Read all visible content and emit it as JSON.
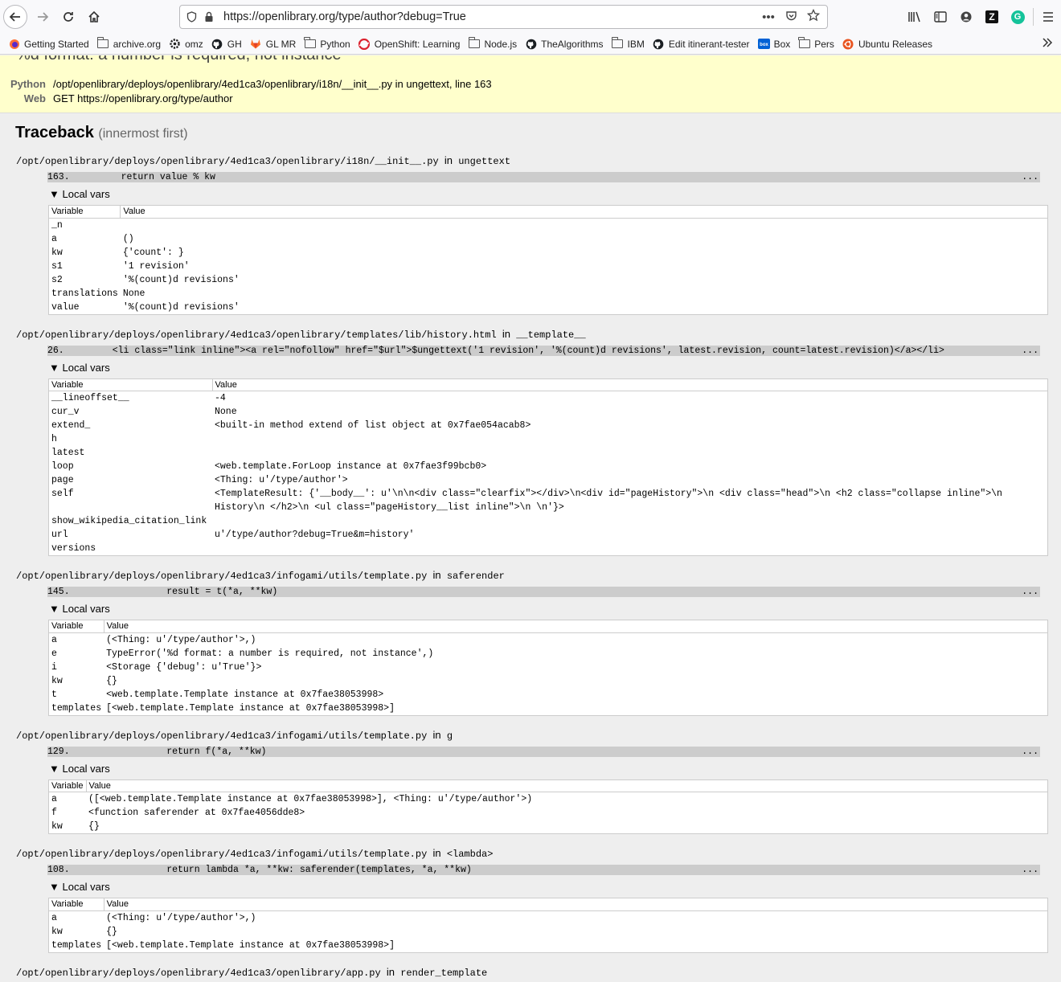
{
  "browser": {
    "url": "https://openlibrary.org/type/author?debug=True",
    "icons": [
      "back-arrow-icon",
      "forward-arrow-icon",
      "reload-icon",
      "home-icon",
      "shield-icon",
      "lock-icon",
      "more-dots-icon",
      "pocket-icon",
      "star-icon",
      "library-icon",
      "sidebar-icon",
      "account-icon",
      "zotero-icon",
      "grammarly-icon",
      "menu-icon"
    ],
    "zotero_letter": "Z",
    "grammarly_letter": "G",
    "more_dots": "•••"
  },
  "bookmarks": [
    {
      "label": "Getting Started",
      "icon": "firefox-icon"
    },
    {
      "label": "archive.org",
      "icon": "folder-icon"
    },
    {
      "label": "omz",
      "icon": "gear-icon"
    },
    {
      "label": "GH",
      "icon": "github-icon"
    },
    {
      "label": "GL MR",
      "icon": "gitlab-icon"
    },
    {
      "label": "Python",
      "icon": "folder-icon"
    },
    {
      "label": "OpenShift: Learning",
      "icon": "openshift-icon"
    },
    {
      "label": "Node.js",
      "icon": "folder-icon"
    },
    {
      "label": "TheAlgorithms",
      "icon": "github-icon"
    },
    {
      "label": "IBM",
      "icon": "folder-icon"
    },
    {
      "label": "Edit itinerant-tester",
      "icon": "github-icon"
    },
    {
      "label": "Box",
      "icon": "box-icon"
    },
    {
      "label": "Pers",
      "icon": "folder-icon"
    },
    {
      "label": "Ubuntu Releases",
      "icon": "ubuntu-icon"
    }
  ],
  "summary": {
    "title": "%d format: a number is required, not instance",
    "python_label": "Python",
    "python_value": "/opt/openlibrary/deploys/openlibrary/4ed1ca3/openlibrary/i18n/__init__.py in ungettext, line 163",
    "web_label": "Web",
    "web_value": "GET https://openlibrary.org/type/author"
  },
  "traceback": {
    "title": "Traceback",
    "subtitle": "(innermost first)",
    "in_word": "in",
    "local_vars_label": "▼ Local vars",
    "variable_header": "Variable",
    "value_header": "Value",
    "ellipsis": "...",
    "frames": [
      {
        "file": "/opt/openlibrary/deploys/openlibrary/4ed1ca3/openlibrary/i18n/__init__.py",
        "func": "ungettext",
        "line_no": "163.",
        "code": "return value % kw",
        "vars": [
          [
            "_n",
            ""
          ],
          [
            "a",
            "()"
          ],
          [
            "kw",
            "{'count': }"
          ],
          [
            "s1",
            "'1 revision'"
          ],
          [
            "s2",
            "'%(count)d revisions'"
          ],
          [
            "translations",
            "None"
          ],
          [
            "value",
            "'%(count)d revisions'"
          ]
        ]
      },
      {
        "file": "/opt/openlibrary/deploys/openlibrary/4ed1ca3/openlibrary/templates/lib/history.html",
        "func": "__template__",
        "line_no": "26.",
        "code": "<li class=\"link inline\"><a rel=\"nofollow\" href=\"$url\">$ungettext('1 revision', '%(count)d revisions', latest.revision, count=latest.revision)</a></li>",
        "vars": [
          [
            "__lineoffset__",
            "-4"
          ],
          [
            "cur_v",
            "None"
          ],
          [
            "extend_",
            "<built-in method extend of list object at 0x7fae054acab8>"
          ],
          [
            "h",
            ""
          ],
          [
            "latest",
            ""
          ],
          [
            "loop",
            "<web.template.ForLoop instance at 0x7fae3f99bcb0>"
          ],
          [
            "page",
            "<Thing: u'/type/author'>"
          ],
          [
            "self",
            "<TemplateResult: {'__body__': u'\\n\\n<div class=\"clearfix\"></div>\\n<div id=\"pageHistory\">\\n <div class=\"head\">\\n <h2 class=\"collapse inline\">\\n History\\n </h2>\\n <ul class=\"pageHistory__list inline\">\\n \\n'}>"
          ],
          [
            "show_wikipedia_citation_link",
            ""
          ],
          [
            "url",
            "u'/type/author?debug=True&m=history'"
          ],
          [
            "versions",
            ""
          ]
        ]
      },
      {
        "file": "/opt/openlibrary/deploys/openlibrary/4ed1ca3/infogami/utils/template.py",
        "func": "saferender",
        "line_no": "145.",
        "code": "    result = t(*a, **kw)",
        "vars": [
          [
            "a",
            "(<Thing: u'/type/author'>,)"
          ],
          [
            "e",
            "TypeError('%d format: a number is required, not instance',)"
          ],
          [
            "i",
            "<Storage {'debug': u'True'}>"
          ],
          [
            "kw",
            "{}"
          ],
          [
            "t",
            "<web.template.Template instance at 0x7fae38053998>"
          ],
          [
            "templates",
            "[<web.template.Template instance at 0x7fae38053998>]"
          ]
        ]
      },
      {
        "file": "/opt/openlibrary/deploys/openlibrary/4ed1ca3/infogami/utils/template.py",
        "func": "g",
        "line_no": "129.",
        "code": "    return f(*a, **kw)",
        "vars": [
          [
            "a",
            "([<web.template.Template instance at 0x7fae38053998>], <Thing: u'/type/author'>)"
          ],
          [
            "f",
            "<function saferender at 0x7fae4056dde8>"
          ],
          [
            "kw",
            "{}"
          ]
        ]
      },
      {
        "file": "/opt/openlibrary/deploys/openlibrary/4ed1ca3/infogami/utils/template.py",
        "func": "<lambda>",
        "line_no": "108.",
        "code": "    return lambda *a, **kw: saferender(templates, *a, **kw)",
        "vars": [
          [
            "a",
            "(<Thing: u'/type/author'>,)"
          ],
          [
            "kw",
            "{}"
          ],
          [
            "templates",
            "[<web.template.Template instance at 0x7fae38053998>]"
          ]
        ]
      },
      {
        "file": "/opt/openlibrary/deploys/openlibrary/4ed1ca3/openlibrary/app.py",
        "func": "render_template",
        "line_no": "",
        "code": "",
        "vars": []
      }
    ]
  }
}
